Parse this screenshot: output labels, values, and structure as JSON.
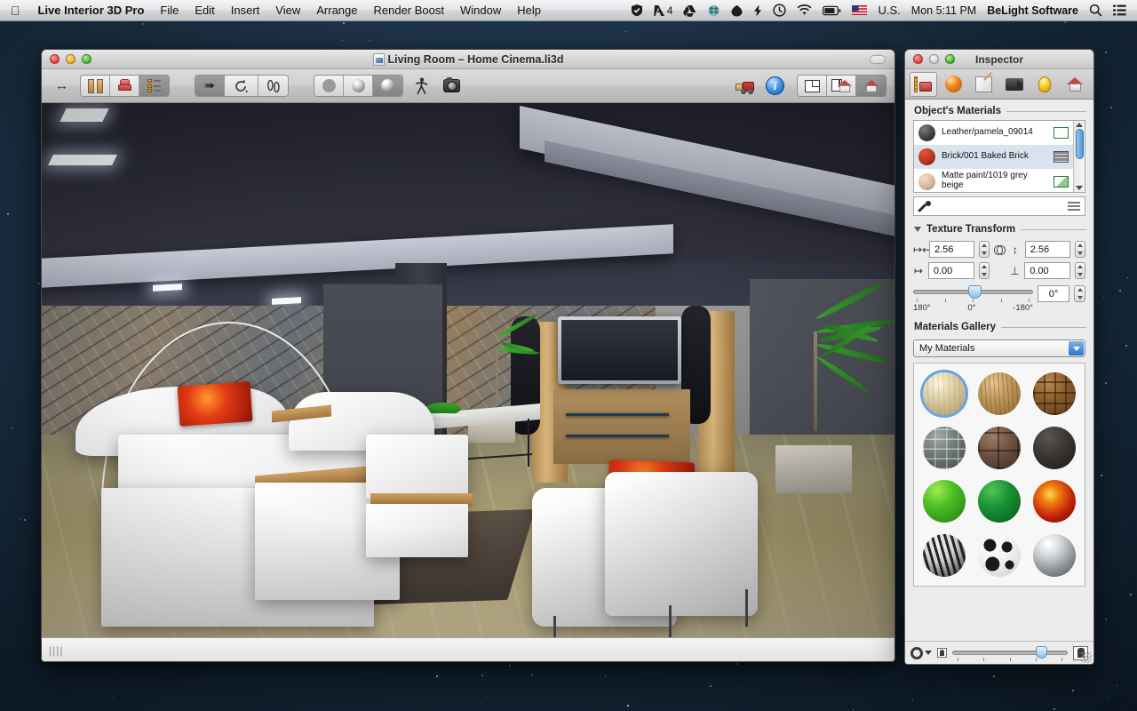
{
  "menubar": {
    "apple_icon": "apple-logo-icon",
    "app_name": "Live Interior 3D Pro",
    "menus": [
      "File",
      "Edit",
      "Insert",
      "View",
      "Arrange",
      "Render Boost",
      "Window",
      "Help"
    ],
    "status_items": [
      {
        "name": "shield-icon",
        "label": ""
      },
      {
        "name": "adobe-icon",
        "label": "4"
      },
      {
        "name": "google-drive-icon",
        "label": ""
      },
      {
        "name": "dropbox-icon",
        "label": ""
      },
      {
        "name": "evernote-icon",
        "label": ""
      },
      {
        "name": "flash-icon",
        "label": ""
      },
      {
        "name": "time-machine-icon",
        "label": ""
      },
      {
        "name": "wifi-icon",
        "label": ""
      },
      {
        "name": "battery-icon",
        "label": ""
      }
    ],
    "input_source": "U.S.",
    "input_flag": "us-flag-icon",
    "clock": "Mon 5:11 PM",
    "user": "BeLight Software",
    "search_icon": "search-icon",
    "notification_icon": "notification-center-icon"
  },
  "window": {
    "title": "Living Room – Home Cinema.li3d",
    "doc_icon": "document-icon",
    "traffic": [
      "close-button",
      "minimize-button",
      "zoom-button"
    ],
    "toolbar": {
      "resize_handle_label": "resize-width-icon",
      "library_group": [
        {
          "name": "objects-library-button",
          "icon": "book-icon",
          "active": false
        },
        {
          "name": "furniture-library-button",
          "icon": "armchair-icon",
          "active": false
        },
        {
          "name": "properties-list-button",
          "icon": "list-icon",
          "active": true
        }
      ],
      "tool_group": [
        {
          "name": "select-tool",
          "icon": "arrow-cursor-icon",
          "active": true
        },
        {
          "name": "rotate-tool",
          "icon": "rotate-icon",
          "active": false
        },
        {
          "name": "walk-tool",
          "icon": "footprints-icon",
          "active": false
        }
      ],
      "render_group": [
        {
          "name": "flat-render-button",
          "icon": "flat-sphere-icon",
          "active": false
        },
        {
          "name": "shaded-render-button",
          "icon": "shaded-sphere-icon",
          "active": false
        },
        {
          "name": "glossy-render-button",
          "icon": "glossy-sphere-icon",
          "active": true
        }
      ],
      "walkthrough_button": {
        "name": "walkthrough-button",
        "icon": "walking-person-icon"
      },
      "camera_button": {
        "name": "camera-button",
        "icon": "camera-icon"
      },
      "render_boost_button": {
        "name": "render-boost-button",
        "icon": "forklift-icon"
      },
      "info_button": {
        "name": "info-button",
        "icon": "info-circle-icon",
        "label": "i"
      },
      "view_group": [
        {
          "name": "floorplan-view-button",
          "icon": "floorplan-icon",
          "active": false
        },
        {
          "name": "split-view-button",
          "icon": "split-view-icon",
          "active": false
        },
        {
          "name": "3d-view-button",
          "icon": "house-3d-icon",
          "active": true
        }
      ]
    },
    "statusbar": {
      "grip": "||||"
    }
  },
  "inspector": {
    "title": "Inspector",
    "traffic": [
      "close-button",
      "minimize-button",
      "zoom-button"
    ],
    "tabs": [
      {
        "name": "tab-object",
        "icon": "ruler-chair-icon",
        "active": true
      },
      {
        "name": "tab-materials",
        "icon": "orange-sphere-icon",
        "active": false
      },
      {
        "name": "tab-edit",
        "icon": "pencil-canvas-icon",
        "active": false
      },
      {
        "name": "tab-camera",
        "icon": "video-camera-icon",
        "active": false
      },
      {
        "name": "tab-light",
        "icon": "light-bulb-icon",
        "active": false
      },
      {
        "name": "tab-building",
        "icon": "house-icon",
        "active": false
      }
    ],
    "objects_materials": {
      "heading": "Object's Materials",
      "rows": [
        {
          "name": "Leather/pamela_09014",
          "color": "#4a4a4a",
          "badge": "texture-badge",
          "selected": false
        },
        {
          "name": "Brick/001 Baked Brick",
          "color": "#b4321a",
          "badge": "brick-badge",
          "selected": true
        },
        {
          "name": "Matte paint/1019 grey beige",
          "color": "#d9b49a",
          "badge": "paint-badge",
          "selected": false
        }
      ],
      "eyedropper_icon": "eyedropper-icon",
      "menu_icon": "list-menu-icon",
      "scroll_up_icon": "scroll-up-arrow",
      "scroll_down_icon": "scroll-down-arrow"
    },
    "texture_transform": {
      "heading": "Texture Transform",
      "disclosure": "disclosure-triangle-open",
      "width": {
        "icon": "width-icon",
        "value": "2.56"
      },
      "height": {
        "icon": "height-icon",
        "value": "2.56"
      },
      "offset_x": {
        "icon": "offset-x-icon",
        "value": "0.00"
      },
      "offset_y": {
        "icon": "offset-y-icon",
        "value": "0.00"
      },
      "link_icon": "link-chain-icon",
      "rotation": {
        "value": "0°",
        "slider_min_label": "180°",
        "slider_mid_label": "0°",
        "slider_max_label": "-180°",
        "slider_position_pct": 46
      }
    },
    "materials_gallery": {
      "heading": "Materials Gallery",
      "selected_collection": "My Materials",
      "swatches": [
        {
          "name": "swatch-light-wood",
          "selected": true,
          "css": "radial-gradient(circle at 36% 24%, #fdf6e0 2%, #e8dcb8 26%, #cbb98c 62%, #a8966b 100%)"
        },
        {
          "name": "swatch-oak-wood",
          "selected": false,
          "css": "radial-gradient(circle at 36% 24%, #e4c493 2%, #c29a5c 38%, #8f6a35 100%)"
        },
        {
          "name": "swatch-parquet-wood",
          "selected": false,
          "css": "radial-gradient(circle at 36% 24%, #b98a4e 2%, #8c5f2c 40%, #5c3c17 100%)"
        },
        {
          "name": "swatch-stone-wall",
          "selected": false,
          "css": "radial-gradient(circle at 36% 24%, #9fa7a5 2%, #707a78 42%, #3f4a48 100%)"
        },
        {
          "name": "swatch-brown-leather",
          "selected": false,
          "css": "radial-gradient(circle at 36% 24%, #9a7a62 2%, #6f5342 42%, #3d2b21 100%)"
        },
        {
          "name": "swatch-dark-asphalt",
          "selected": false,
          "css": "radial-gradient(circle at 36% 24%, #585450 2%, #3a3633 44%, #1a1816 100%)"
        },
        {
          "name": "swatch-light-green",
          "selected": false,
          "css": "radial-gradient(circle at 33% 24%, #9de84f 3%, #4cc024 38%, #1f7c10 100%)"
        },
        {
          "name": "swatch-dark-green",
          "selected": false,
          "css": "radial-gradient(circle at 33% 24%, #4fc055 3%, #189334 40%, #07571b 100%)"
        },
        {
          "name": "swatch-fire",
          "selected": false,
          "css": "radial-gradient(circle at 40% 34%, #ffd24a 2%, #f07b10 24%, #c01f0b 60%, #6a0b04 100%)"
        },
        {
          "name": "swatch-zebra",
          "selected": false,
          "css": "radial-gradient(circle at 36% 24%, #f2f2f2 2%, #cfcfcf 40%, #2a2a2a 100%)"
        },
        {
          "name": "swatch-cow-spots",
          "selected": false,
          "css": "radial-gradient(circle at 36% 24%, #ffffff 2%, #f0f0f0 45%, #cfcfcf 100%)"
        },
        {
          "name": "swatch-chrome",
          "selected": false,
          "css": "radial-gradient(circle at 36% 22%, #ffffff 2%, #d2d6da 30%, #8e949a 62%, #4c5155 100%)"
        }
      ]
    },
    "bottom_bar": {
      "gear_icon": "gear-action-menu",
      "small_preview_icon": "small-thumbnail-icon",
      "large_preview_icon": "large-thumbnail-icon",
      "zoom_position_pct": 72,
      "resize_grip": "resize-grip-icon"
    }
  },
  "scene": {
    "description": "3D rendered living room with home cinema",
    "colors": {
      "ceiling": "#2b2c38",
      "stone_wall": "#7d7a72",
      "floor": "#a89c6f",
      "sofa": "#ffffff",
      "pillow": "#e23b14",
      "plant": "#3fae34",
      "tv_screen": "#1a1d23"
    }
  }
}
